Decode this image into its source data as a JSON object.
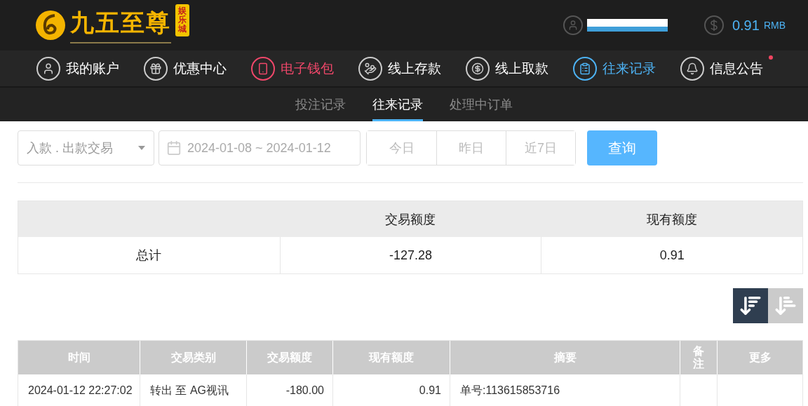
{
  "header": {
    "logo": {
      "title": "九五至尊",
      "subtitle": "娱乐城"
    },
    "balance": {
      "amount": "0.91",
      "currency": "RMB"
    }
  },
  "nav": [
    {
      "label": "我的账户",
      "selected": false,
      "hovered": false,
      "has_notice": false
    },
    {
      "label": "优惠中心",
      "selected": false,
      "hovered": false,
      "has_notice": false
    },
    {
      "label": "电子钱包",
      "selected": false,
      "hovered": true,
      "has_notice": false
    },
    {
      "label": "线上存款",
      "selected": false,
      "hovered": false,
      "has_notice": false
    },
    {
      "label": "线上取款",
      "selected": false,
      "hovered": false,
      "has_notice": false
    },
    {
      "label": "往来记录",
      "selected": true,
      "hovered": false,
      "has_notice": false
    },
    {
      "label": "信息公告",
      "selected": false,
      "hovered": false,
      "has_notice": true
    }
  ],
  "subtabs": [
    {
      "label": "投注记录",
      "selected": false
    },
    {
      "label": "往来记录",
      "selected": true
    },
    {
      "label": "处理中订单",
      "selected": false
    }
  ],
  "filters": {
    "type_select": "入款 . 出款交易",
    "date_range": "2024-01-08 ~ 2024-01-12",
    "quick_ranges": [
      {
        "label": "今日",
        "selected": false
      },
      {
        "label": "昨日",
        "selected": false
      },
      {
        "label": "近7日",
        "selected": false
      }
    ],
    "query_button": "查询"
  },
  "summary": {
    "columns": [
      "交易额度",
      "现有额度"
    ],
    "row": {
      "label": "总计",
      "values": [
        "-127.28",
        "0.91"
      ]
    }
  },
  "sort": [
    {
      "selected": true
    },
    {
      "selected": false
    }
  ],
  "table": {
    "columns": [
      "时间",
      "交易类别",
      "交易额度",
      "现有额度",
      "摘要",
      "备注",
      "更多"
    ],
    "rows": [
      {
        "cells": [
          "2024-01-12 22:27:02",
          "转出 至 AG视讯",
          "-180.00",
          "0.91",
          "单号:113615853716",
          "",
          ""
        ]
      }
    ]
  }
}
